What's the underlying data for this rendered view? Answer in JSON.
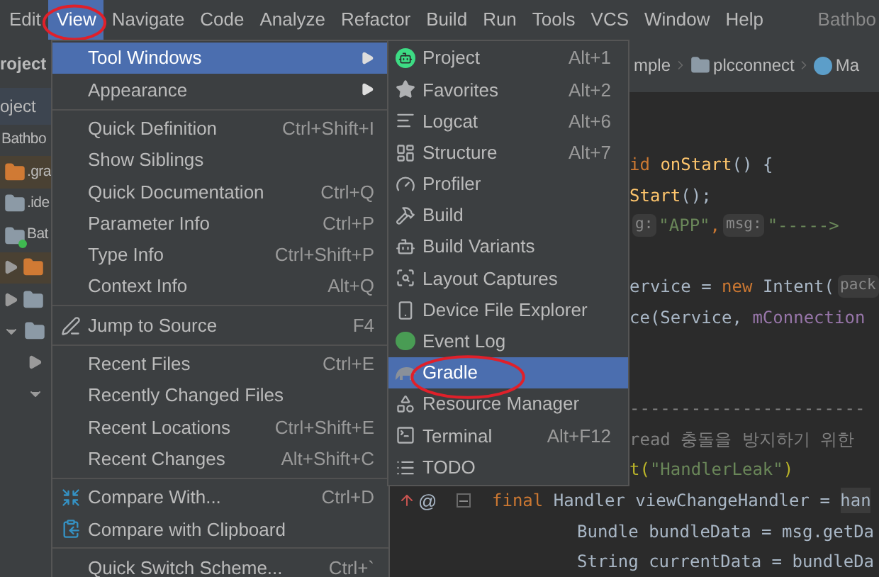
{
  "menubar": {
    "items": [
      {
        "label": "Edit",
        "selected": false,
        "circled": false
      },
      {
        "label": "View",
        "selected": true,
        "circled": true
      },
      {
        "label": "Navigate",
        "selected": false,
        "circled": false
      },
      {
        "label": "Code",
        "selected": false,
        "circled": false
      },
      {
        "label": "Analyze",
        "selected": false,
        "circled": false
      },
      {
        "label": "Refactor",
        "selected": false,
        "circled": false
      },
      {
        "label": "Build",
        "selected": false,
        "circled": false
      },
      {
        "label": "Run",
        "selected": false,
        "circled": false
      },
      {
        "label": "Tools",
        "selected": false,
        "circled": false
      },
      {
        "label": "VCS",
        "selected": false,
        "circled": false
      },
      {
        "label": "Window",
        "selected": false,
        "circled": false
      },
      {
        "label": "Help",
        "selected": false,
        "circled": false
      }
    ],
    "project_title": "Bathbo"
  },
  "project_panel": {
    "title": "roject",
    "view_selector": "oject",
    "tree": [
      {
        "label": "Bathbo",
        "highlighted": false,
        "children": [
          {
            "label": ".gra",
            "kind": "excluded",
            "highlighted": true
          },
          {
            "label": ".ide",
            "kind": "folder",
            "highlighted": false
          },
          {
            "label": "Bat",
            "kind": "module",
            "highlighted": false,
            "children": [
              {
                "kind": "excluded",
                "highlighted": true,
                "expanded": false
              },
              {
                "kind": "folder",
                "highlighted": false,
                "expanded": false
              },
              {
                "kind": "folder",
                "highlighted": false,
                "expanded": true,
                "children": [
                  {
                    "highlighted": false,
                    "expanded": false
                  },
                  {
                    "highlighted": false,
                    "expanded": true
                  }
                ]
              }
            ]
          }
        ]
      }
    ]
  },
  "breadcrumb": [
    "mple",
    "plcconnect",
    "Ma"
  ],
  "code_blocks": [
    [
      {
        "segments": [
          {
            "text": "id ",
            "kind": "keyword"
          },
          {
            "text": "onStart",
            "kind": "method"
          },
          {
            "text": "() {",
            "kind": "plain"
          }
        ]
      },
      {
        "segments": [
          {
            "text": "Start",
            "kind": "method"
          },
          {
            "text": "();",
            "kind": "plain"
          }
        ]
      },
      {
        "segments": [
          {
            "text": "g:",
            "kind": "hint"
          },
          {
            "text": "\"APP\"",
            "kind": "string"
          },
          {
            "text": ",",
            "kind": "keyword"
          },
          {
            "text": "msg:",
            "kind": "hint"
          },
          {
            "text": "\"----->",
            "kind": "string"
          }
        ]
      }
    ],
    [
      {
        "segments": [
          {
            "text": "ervice = ",
            "kind": "plain"
          },
          {
            "text": "new ",
            "kind": "keyword"
          },
          {
            "text": "Intent(",
            "kind": "plain"
          },
          {
            "text": "pack",
            "kind": "hint"
          }
        ]
      },
      {
        "segments": [
          {
            "text": "ce(Service, ",
            "kind": "plain"
          },
          {
            "text": "mConnection",
            "kind": "field"
          }
        ]
      }
    ],
    [
      {
        "segments": [
          {
            "text": "-----------------------",
            "kind": "comment"
          }
        ]
      },
      {
        "segments": [
          {
            "text": "read 충돌을 방지하기 위한",
            "kind": "comment"
          }
        ]
      },
      {
        "segments": [
          {
            "text": "t(",
            "kind": "annotation"
          },
          {
            "text": "\"HandlerLeak\"",
            "kind": "string"
          },
          {
            "text": ")",
            "kind": "annotation"
          }
        ]
      }
    ]
  ],
  "gutter_code": [
    {
      "gutter_mark": "@",
      "segments": [
        {
          "text": "final ",
          "kind": "keyword"
        },
        {
          "text": "Handler viewChangeHandler = ",
          "kind": "plain"
        },
        {
          "text": "han",
          "kind": "highlight"
        }
      ],
      "children": [
        {
          "segments": [
            {
              "text": "Bundle bundleData = msg.getDa",
              "kind": "plain"
            }
          ]
        },
        {
          "segments": [
            {
              "text": "String currentData = bundleDa",
              "kind": "plain"
            }
          ]
        }
      ]
    }
  ],
  "view_menu": {
    "groups": [
      [
        {
          "label": "Tool Windows",
          "submenu": true,
          "selected": true
        },
        {
          "label": "Appearance",
          "submenu": true,
          "selected": false
        }
      ],
      [
        {
          "label": "Quick Definition",
          "shortcut": "Ctrl+Shift+I",
          "selected": false
        },
        {
          "label": "Show Siblings",
          "selected": false
        },
        {
          "label": "Quick Documentation",
          "shortcut": "Ctrl+Q",
          "selected": false
        },
        {
          "label": "Parameter Info",
          "shortcut": "Ctrl+P",
          "selected": false
        },
        {
          "label": "Type Info",
          "shortcut": "Ctrl+Shift+P",
          "selected": false
        },
        {
          "label": "Context Info",
          "shortcut": "Alt+Q",
          "selected": false
        }
      ],
      [
        {
          "label": "Jump to Source",
          "shortcut": "F4",
          "selected": false
        }
      ],
      [
        {
          "label": "Recent Files",
          "shortcut": "Ctrl+E",
          "selected": false
        },
        {
          "label": "Recently Changed Files",
          "selected": false
        },
        {
          "label": "Recent Locations",
          "shortcut": "Ctrl+Shift+E",
          "selected": false
        },
        {
          "label": "Recent Changes",
          "shortcut": "Alt+Shift+C",
          "selected": false
        }
      ],
      [
        {
          "label": "Compare With...",
          "shortcut": "Ctrl+D",
          "selected": false
        },
        {
          "label": "Compare with Clipboard",
          "selected": false
        }
      ],
      [
        {
          "label": "Quick Switch Scheme...",
          "shortcut": "Ctrl+`",
          "selected": false
        }
      ]
    ]
  },
  "tool_windows_menu": {
    "items": [
      {
        "label": "Project",
        "shortcut": "Alt+1",
        "selected": false,
        "circled": false
      },
      {
        "label": "Favorites",
        "shortcut": "Alt+2",
        "selected": false,
        "circled": false
      },
      {
        "label": "Logcat",
        "shortcut": "Alt+6",
        "selected": false,
        "circled": false
      },
      {
        "label": "Structure",
        "shortcut": "Alt+7",
        "selected": false,
        "circled": false
      },
      {
        "label": "Profiler",
        "selected": false,
        "circled": false
      },
      {
        "label": "Build",
        "selected": false,
        "circled": false
      },
      {
        "label": "Build Variants",
        "selected": false,
        "circled": false
      },
      {
        "label": "Layout Captures",
        "selected": false,
        "circled": false
      },
      {
        "label": "Device File Explorer",
        "selected": false,
        "circled": false
      },
      {
        "label": "Event Log",
        "selected": false,
        "circled": false
      },
      {
        "label": "Gradle",
        "selected": true,
        "circled": true
      },
      {
        "label": "Resource Manager",
        "selected": false,
        "circled": false
      },
      {
        "label": "Terminal",
        "shortcut": "Alt+F12",
        "selected": false,
        "circled": false
      },
      {
        "label": "TODO",
        "selected": false,
        "circled": false
      }
    ]
  }
}
